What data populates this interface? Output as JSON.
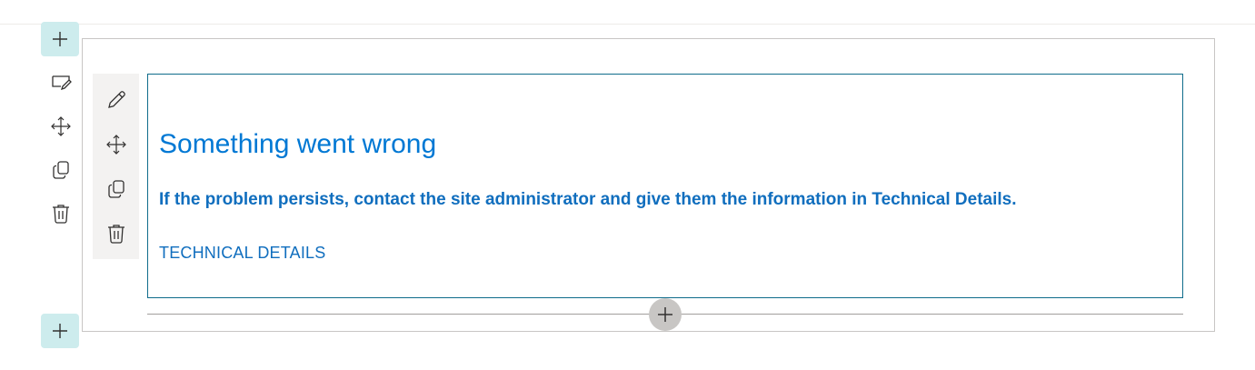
{
  "canvas": {
    "section_toolbar": {
      "add_top": {
        "icon": "plus-icon"
      },
      "edit": {
        "icon": "edit-section-icon"
      },
      "move": {
        "icon": "move-icon"
      },
      "duplicate": {
        "icon": "copy-icon"
      },
      "delete": {
        "icon": "trash-icon"
      },
      "add_bottom": {
        "icon": "plus-icon"
      }
    },
    "webpart_toolbar": {
      "edit": {
        "icon": "pencil-icon"
      },
      "move": {
        "icon": "move-icon"
      },
      "duplicate": {
        "icon": "copy-icon"
      },
      "delete": {
        "icon": "trash-icon"
      }
    },
    "error": {
      "title": "Something went wrong",
      "message": "If the problem persists, contact the site administrator and give them the information in Technical Details.",
      "details_link": "TECHNICAL DETAILS"
    },
    "add_webpart": {
      "icon": "plus-icon"
    }
  },
  "colors": {
    "accent": "#0078d4",
    "link": "#106ebe",
    "add_button_bg": "#cdeced",
    "toolbar_bg": "#f3f2f1",
    "webpart_border": "#0f6c8b"
  }
}
